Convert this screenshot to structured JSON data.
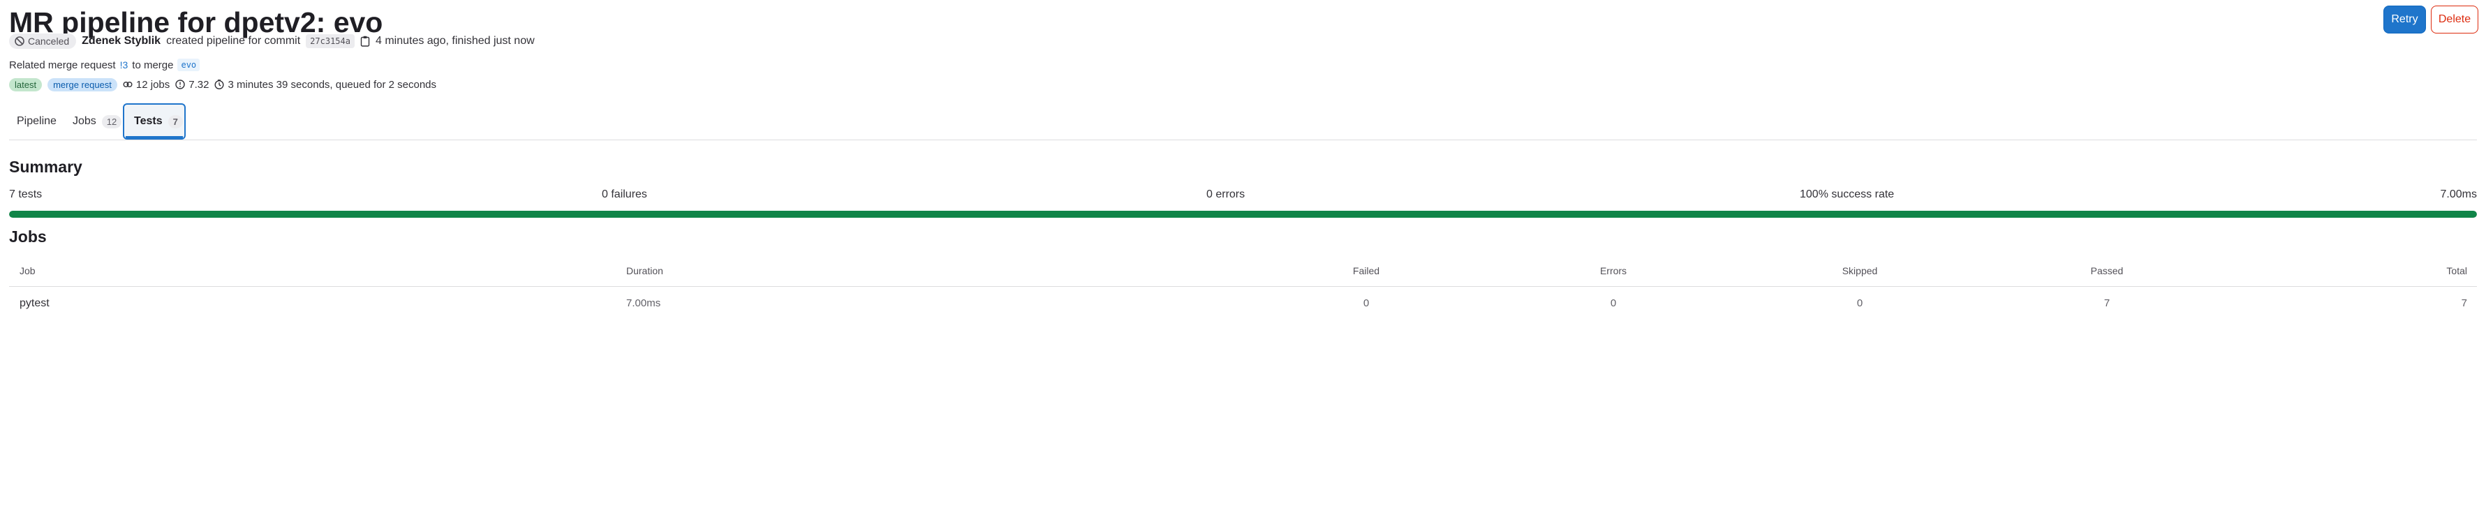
{
  "header": {
    "title": "MR pipeline for dpetv2: evo",
    "status_badge": "Canceled",
    "author": "Zdenek Styblik",
    "created_text": "created pipeline for commit",
    "commit_sha": "27c3154a",
    "time_text": "4 minutes ago, finished just now",
    "actions": {
      "retry_label": "Retry",
      "delete_label": "Delete"
    }
  },
  "merge_request": {
    "prefix": "Related merge request",
    "link": "!3",
    "to_merge_text": "to merge",
    "branch": "evo"
  },
  "info": {
    "badges": [
      "latest",
      "merge request"
    ],
    "jobs_count": "12 jobs",
    "duration_value": "7.32",
    "timing_text": "3 minutes 39 seconds, queued for 2 seconds"
  },
  "tabs": [
    {
      "label": "Pipeline",
      "count": ""
    },
    {
      "label": "Jobs",
      "count": "12"
    },
    {
      "label": "Tests",
      "count": "7"
    }
  ],
  "summary": {
    "title": "Summary",
    "tests": "7 tests",
    "failures": "0 failures",
    "errors": "0 errors",
    "success_rate": "100% success rate",
    "duration": "7.00ms",
    "success_fraction": 1.0
  },
  "jobs": {
    "title": "Jobs",
    "columns": [
      "Job",
      "Duration",
      "Failed",
      "Errors",
      "Skipped",
      "Passed",
      "Total"
    ],
    "rows": [
      {
        "job": "pytest",
        "duration": "7.00ms",
        "failed": "0",
        "errors": "0",
        "skipped": "0",
        "passed": "7",
        "total": "7"
      }
    ]
  },
  "colors": {
    "primary": "#1f75cb",
    "danger": "#dd2b0e",
    "success": "#108548",
    "latest_badge_bg": "#c3e6cd",
    "mr_badge_bg": "#cbe2f9"
  },
  "icons": [
    "canceled-icon",
    "clipboard-icon",
    "jobs-icon",
    "duration-icon",
    "clock-icon"
  ]
}
